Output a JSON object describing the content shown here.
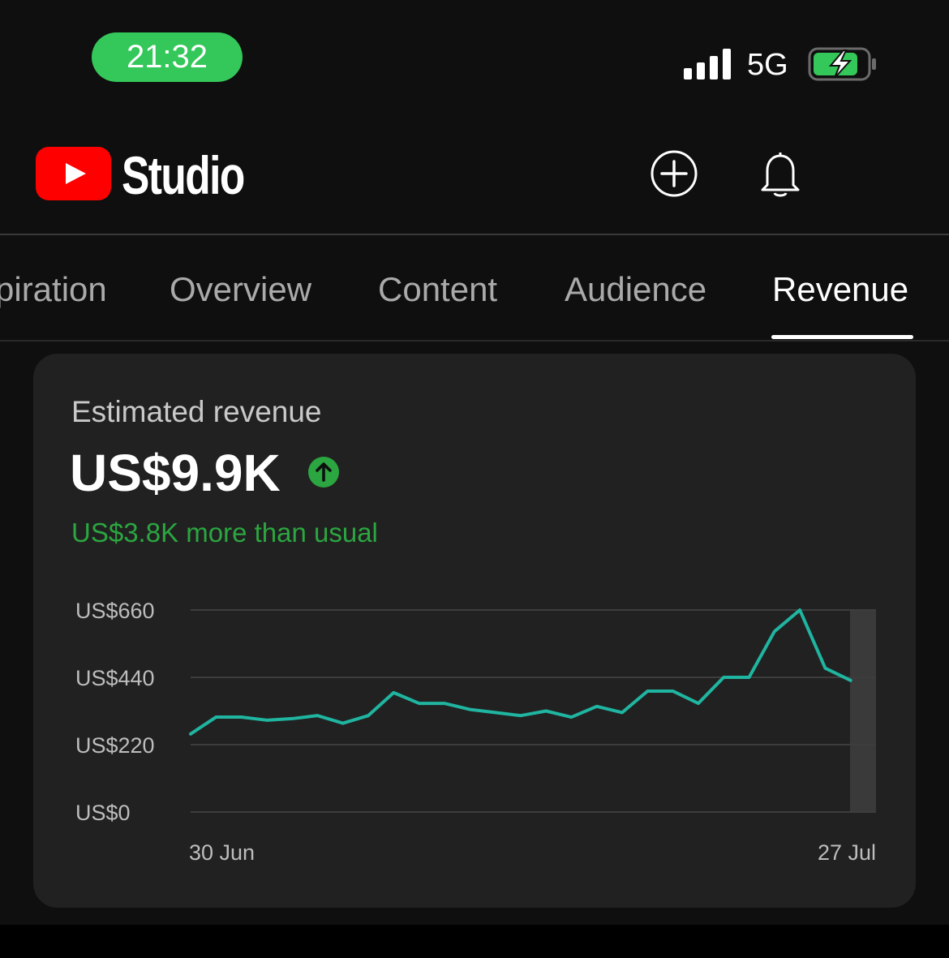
{
  "status_bar": {
    "time": "21:32",
    "network": "5G",
    "signal_icon": "signal-bars-icon",
    "battery_icon": "battery-charging-icon"
  },
  "header": {
    "logo_icon": "youtube-logo-icon",
    "title": "Studio",
    "create_icon": "add-circle-icon",
    "notifications_icon": "bell-icon"
  },
  "tabs": [
    {
      "label": "piration",
      "active": false
    },
    {
      "label": "Overview",
      "active": false
    },
    {
      "label": "Content",
      "active": false
    },
    {
      "label": "Audience",
      "active": false
    },
    {
      "label": "Revenue",
      "active": true
    }
  ],
  "card": {
    "title": "Estimated revenue",
    "value": "US$9.9K",
    "trend_icon": "arrow-up-circle-icon",
    "comparison": "US$3.8K more than usual"
  },
  "colors": {
    "background": "#0f0f0f",
    "card": "#212121",
    "line": "#1fb5a0",
    "positive": "#2ba640",
    "status_time": "#34c759",
    "youtube_red": "#ff0000"
  },
  "chart_data": {
    "type": "line",
    "title": "",
    "xlabel": "",
    "ylabel": "",
    "x_tick_labels": [
      "30 Jun",
      "27 Jul"
    ],
    "y_tick_labels": [
      "US$660",
      "US$440",
      "US$220",
      "US$0"
    ],
    "y_ticks": [
      660,
      440,
      220,
      0
    ],
    "ylim": [
      0,
      660
    ],
    "grid": true,
    "x": [
      "30 Jun",
      "1 Jul",
      "2 Jul",
      "3 Jul",
      "4 Jul",
      "5 Jul",
      "6 Jul",
      "7 Jul",
      "8 Jul",
      "9 Jul",
      "10 Jul",
      "11 Jul",
      "12 Jul",
      "13 Jul",
      "14 Jul",
      "15 Jul",
      "16 Jul",
      "17 Jul",
      "18 Jul",
      "19 Jul",
      "20 Jul",
      "21 Jul",
      "22 Jul",
      "23 Jul",
      "24 Jul",
      "25 Jul",
      "26 Jul",
      "27 Jul"
    ],
    "series": [
      {
        "values": [
          255,
          310,
          310,
          300,
          305,
          315,
          290,
          315,
          390,
          355,
          355,
          335,
          325,
          315,
          330,
          310,
          345,
          325,
          395,
          395,
          355,
          440,
          440,
          590,
          660,
          470,
          430,
          null
        ]
      }
    ]
  }
}
